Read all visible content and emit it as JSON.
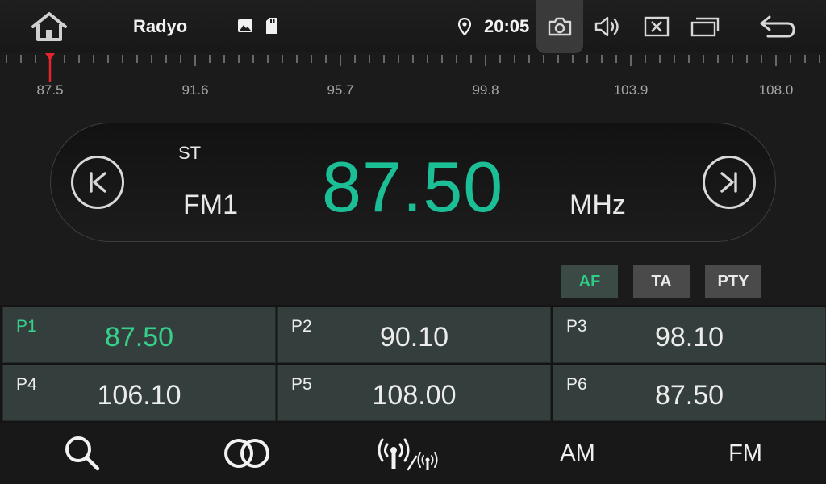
{
  "status_bar": {
    "title": "Radyo",
    "clock": "20:05",
    "icons": [
      "home-icon",
      "image-icon",
      "sd-card-icon",
      "location-icon",
      "camera-icon",
      "volume-icon",
      "close-window-icon",
      "multi-window-icon",
      "back-icon"
    ]
  },
  "scale": {
    "labels": [
      "87.5",
      "91.6",
      "95.7",
      "99.8",
      "103.9",
      "108.0"
    ],
    "indicator_color": "#e3262d"
  },
  "display": {
    "stereo": "ST",
    "band": "FM1",
    "frequency": "87.50",
    "unit": "MHz",
    "accent_color": "#1cbf95"
  },
  "flags": {
    "af": "AF",
    "ta": "TA",
    "pty": "PTY"
  },
  "presets": [
    {
      "num": "P1",
      "freq": "87.50"
    },
    {
      "num": "P2",
      "freq": "90.10"
    },
    {
      "num": "P3",
      "freq": "98.10"
    },
    {
      "num": "P4",
      "freq": "106.10"
    },
    {
      "num": "P5",
      "freq": "108.00"
    },
    {
      "num": "P6",
      "freq": "87.50"
    }
  ],
  "bottom_bar": {
    "am": "AM",
    "fm": "FM",
    "icons": [
      "search-icon",
      "loop-icon",
      "antenna-icon"
    ]
  }
}
